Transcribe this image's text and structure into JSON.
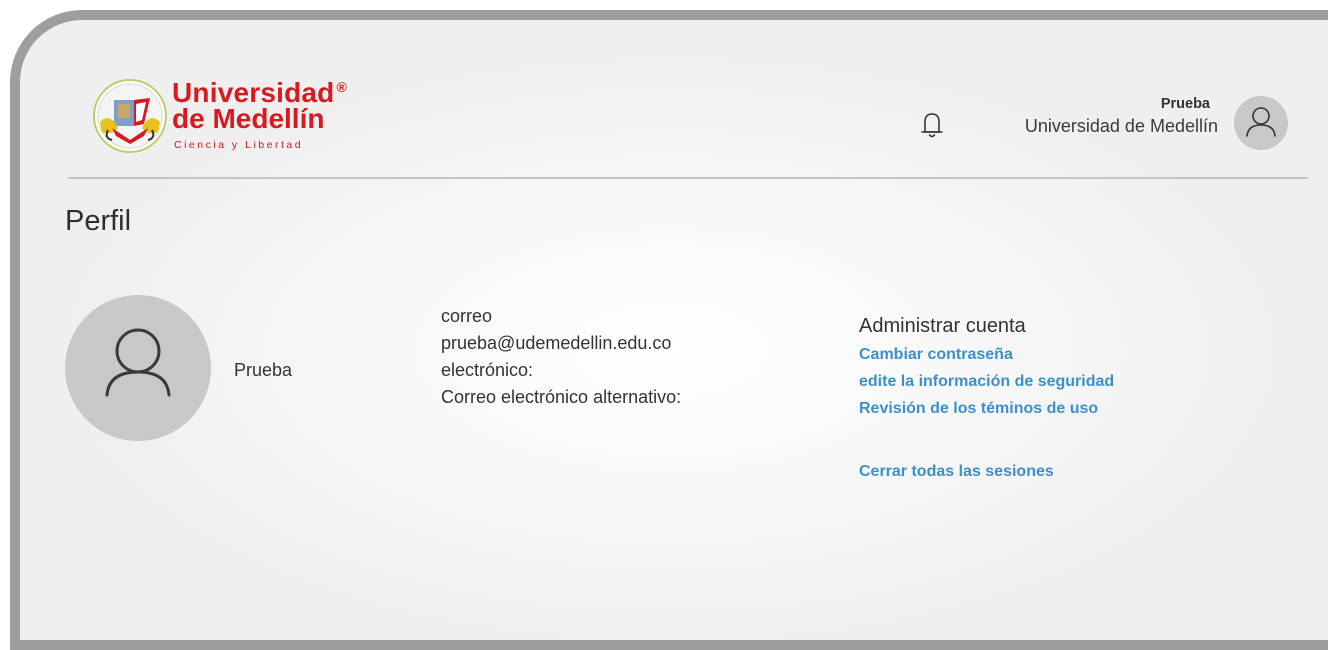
{
  "header": {
    "logo": {
      "line1": "Universidad",
      "registered": "®",
      "line2": "de Medellín",
      "tagline": "Ciencia y Libertad"
    },
    "notifications_icon": "bell-icon",
    "user": {
      "name": "Prueba",
      "organization": "Universidad de Medellín",
      "avatar_icon": "user-icon"
    }
  },
  "page": {
    "title": "Perfil"
  },
  "profile": {
    "avatar_icon": "user-icon",
    "name": "Prueba",
    "email_label_part1": "correo",
    "email_value": "prueba@udemedellin.edu.co",
    "email_label_part2": "electrónico:",
    "alt_email_label": "Correo electrónico alternativo:"
  },
  "account": {
    "title": "Administrar cuenta",
    "change_password": "Cambiar contraseña",
    "edit_security": "edite la información de seguridad",
    "review_terms": "Revisión de los téminos de uso",
    "sign_out_all": "Cerrar todas las sesiones"
  },
  "colors": {
    "brand_red": "#d71920",
    "link_blue": "#3c8fcb",
    "frame_gray": "#9e9e9e",
    "avatar_gray": "#c8c8c8"
  }
}
